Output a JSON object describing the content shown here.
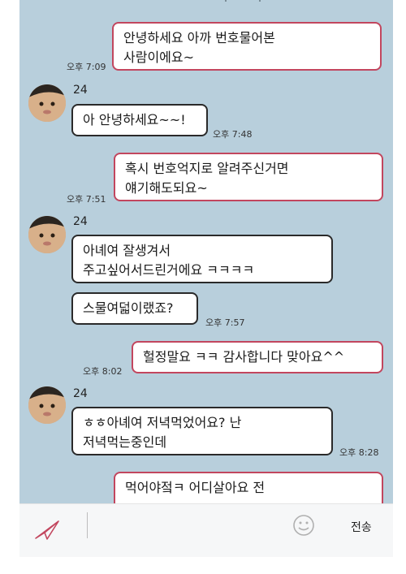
{
  "messages": [
    {
      "text": "안녕하세요 아까 번호물어본\n사람이에요~",
      "time": "오후 7:09"
    },
    {
      "name": "24",
      "text": "아 안녕하세요~~!",
      "time": "오후 7:48"
    },
    {
      "text": "혹시 번호억지로 알려주신거면\n얘기해도되요~",
      "time": "오후 7:51"
    },
    {
      "name": "24",
      "text": "아녜여 잘생겨서\n주고싶어서드린거에요 ㅋㅋㅋㅋ"
    },
    {
      "text": "스물여덟이랬죠?",
      "time": "오후 7:57"
    },
    {
      "text": "헐정말요 ㅋㅋ 감사합니다 맞아요^^",
      "time": "오후 8:02"
    },
    {
      "name": "24",
      "text": "ㅎㅎ아녜여 저녁먹었어요? 난\n저녁먹는중인데",
      "time": "오후 8:28"
    },
    {
      "text": "먹어야젘ㅋ 어디살아요 전"
    }
  ],
  "input": {
    "send_label": "전송",
    "send_icon": "paper-plane-icon",
    "emoji_icon": "smiley-icon"
  },
  "colors": {
    "chat_bg": "#b8cfdc",
    "my_border": "#c2465e",
    "their_border": "#2a2a2a"
  }
}
